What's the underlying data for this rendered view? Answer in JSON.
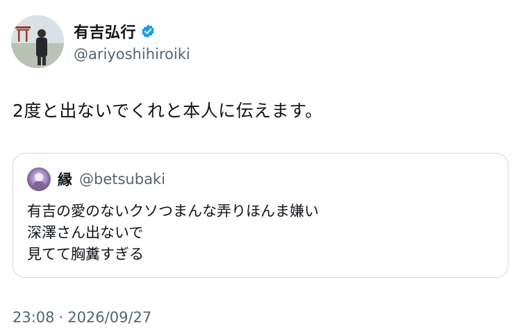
{
  "author": {
    "display_name": "有吉弘行",
    "handle": "@ariyoshihiroiki",
    "verified": true
  },
  "tweet": {
    "text": "2度と出ないでくれと本人に伝えます。"
  },
  "quote": {
    "display_name": "縁",
    "handle": "@betsubaki",
    "lines": [
      "有吉の愛のないクソつまんな弄りほんま嫌い",
      "深澤さん出ないで",
      "見てて胸糞すぎる"
    ]
  },
  "timestamp": {
    "time": "23:08",
    "separator": "·",
    "date": "2026/09/27"
  },
  "colors": {
    "verified_blue": "#1d9bf0",
    "secondary_text": "#536471",
    "border": "#cfd9de"
  },
  "icons": {
    "verified": "verified-badge-icon"
  }
}
